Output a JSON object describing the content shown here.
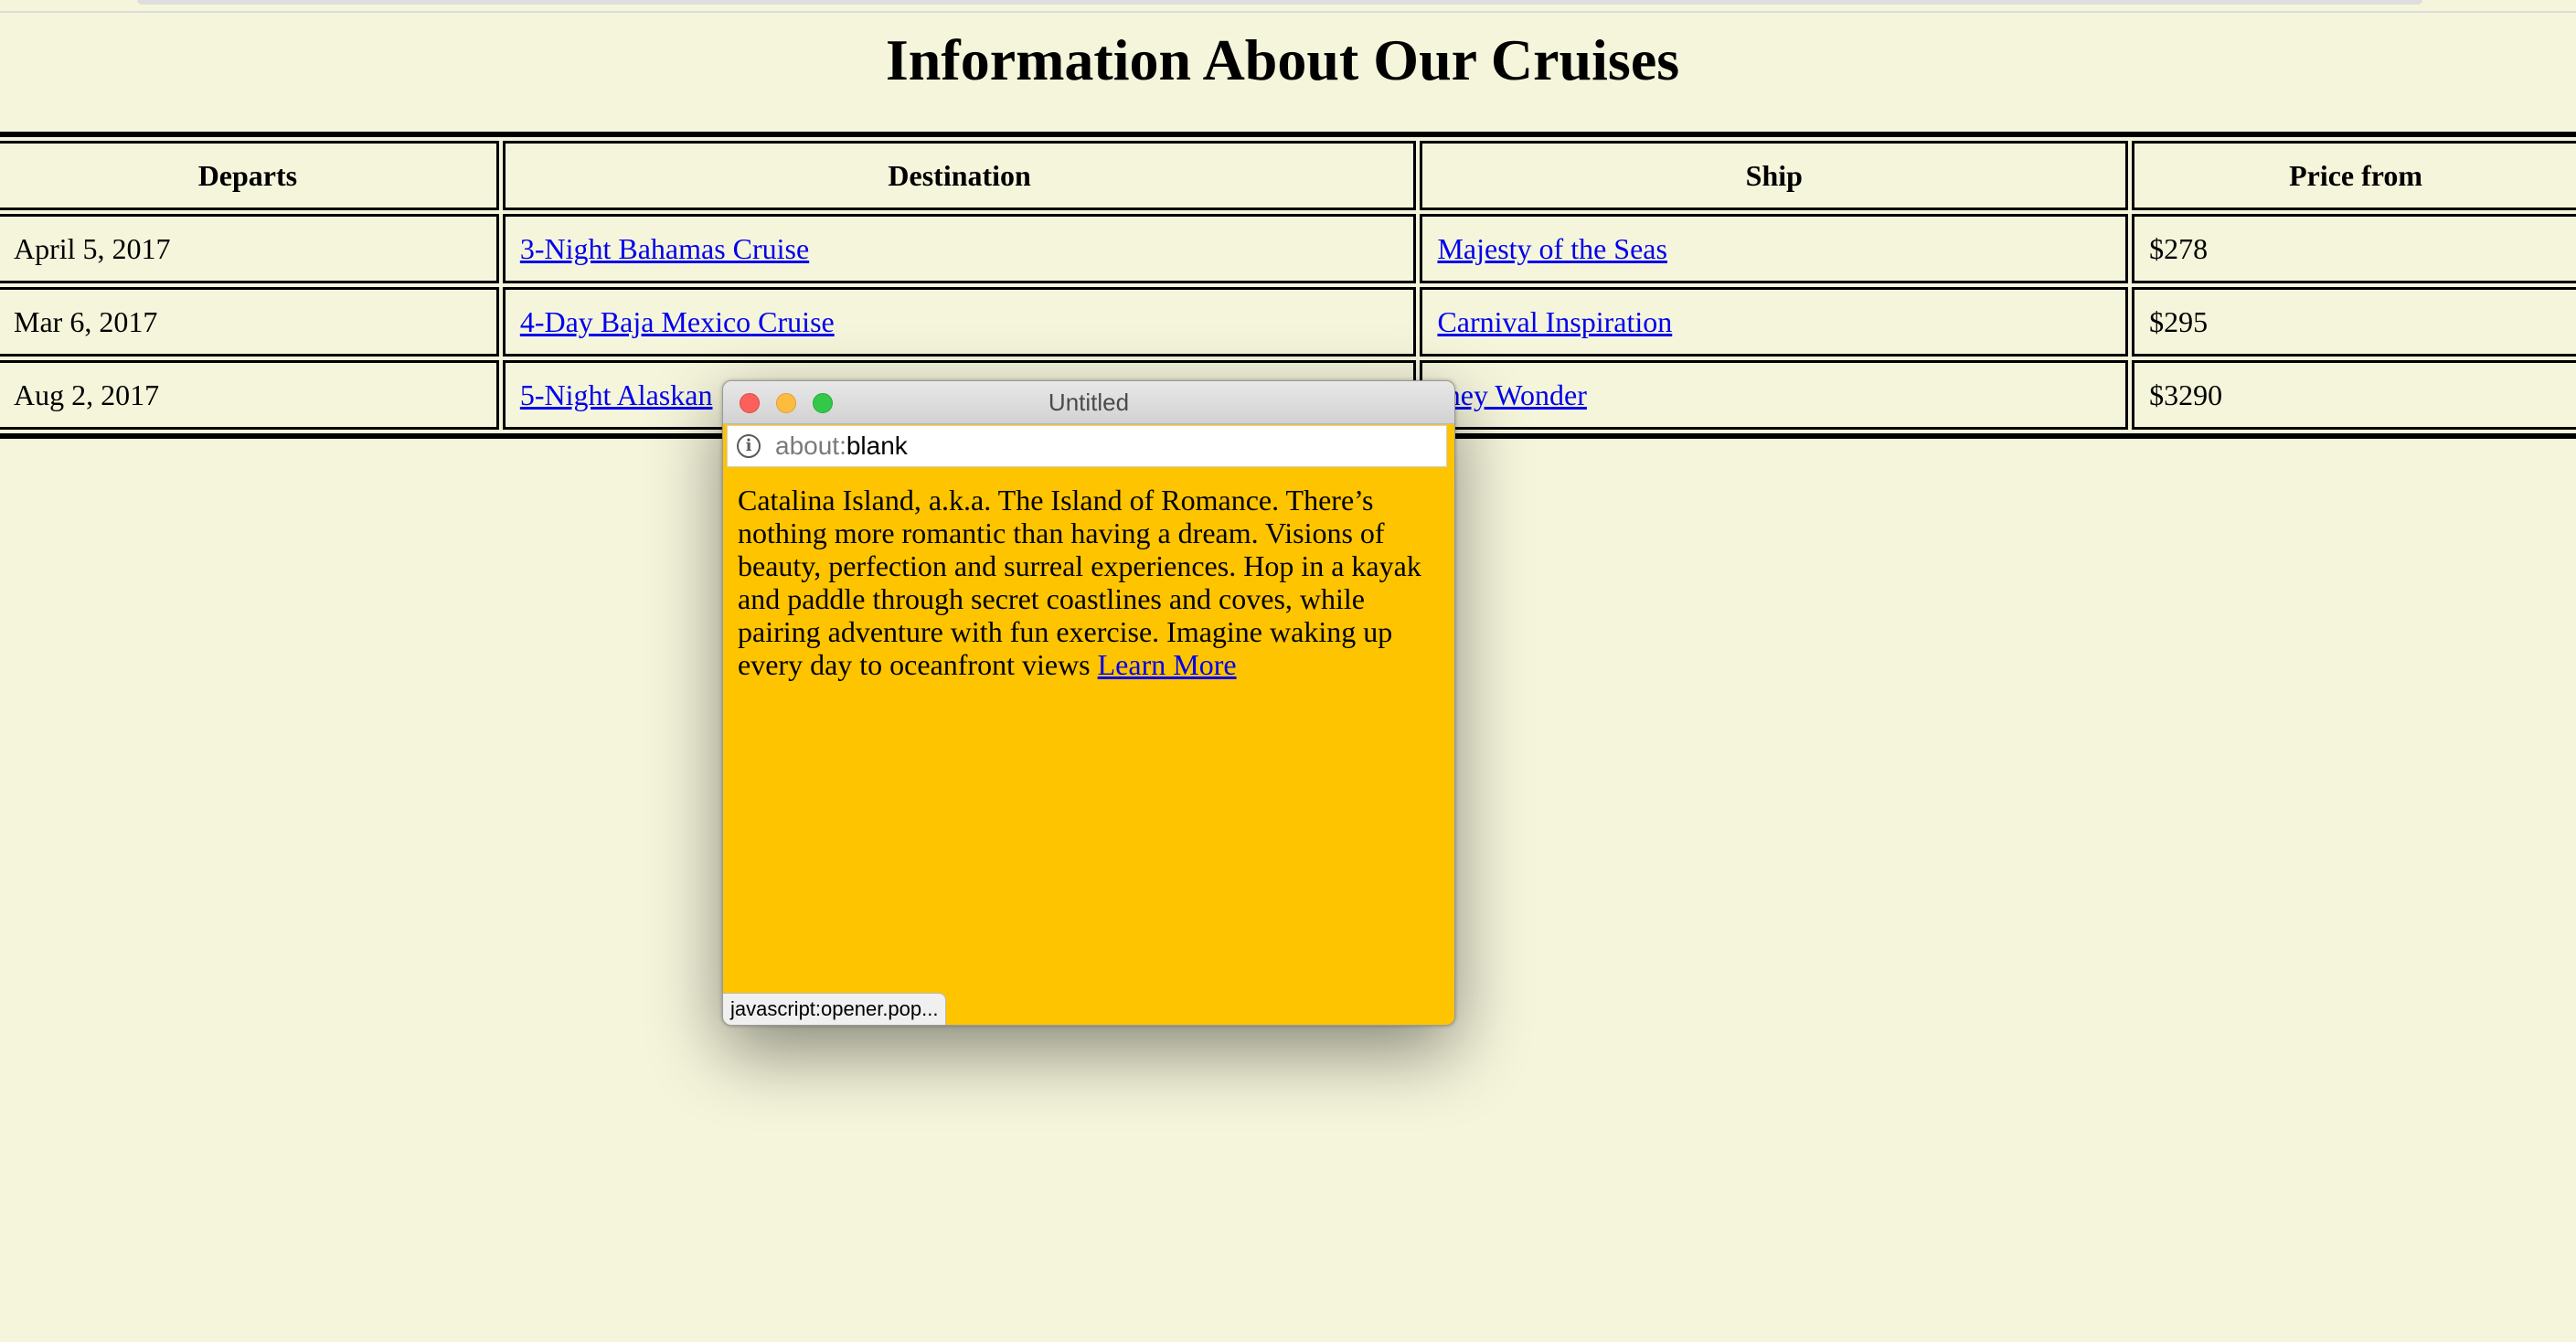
{
  "page": {
    "heading": "Information About Our Cruises"
  },
  "table": {
    "headers": [
      "Departs",
      "Destination",
      "Ship",
      "Price from"
    ],
    "rows": [
      {
        "departs": "April 5, 2017",
        "destination": "3-Night Bahamas Cruise",
        "ship": "Majesty of the Seas",
        "price": "$278"
      },
      {
        "departs": "Mar 6, 2017",
        "destination": "4-Day Baja Mexico Cruise",
        "ship": "Carnival Inspiration",
        "price": "$295"
      },
      {
        "departs": "Aug 2, 2017",
        "destination": "5-Night Alaskan",
        "ship": "isney Wonder",
        "price": "$3290"
      }
    ]
  },
  "popup": {
    "window_title": "Untitled",
    "url_scheme": "about:",
    "url_rest": "blank",
    "body_text": "Catalina Island, a.k.a. The Island of Romance. There’s nothing more romantic than having a dream. Visions of beauty, perfection and surreal experiences. Hop in a kayak and paddle through secret coastlines and coves, while pairing adventure with fun exercise. Imagine waking up every day to oceanfront views",
    "link_text": "Learn More",
    "status_text": "javascript:opener.pop...",
    "background_color": "#fec400"
  },
  "colors": {
    "page_background": "#f5f5dc",
    "link": "#0000ee"
  },
  "icons": [
    "close-window-icon",
    "minimize-window-icon",
    "maximize-window-icon",
    "info-icon"
  ]
}
